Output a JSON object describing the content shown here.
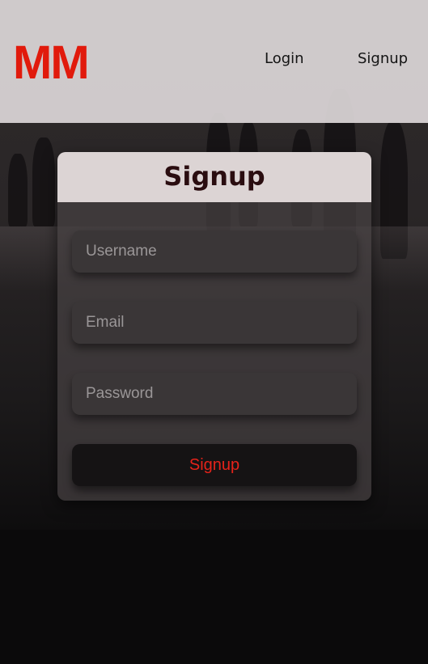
{
  "header": {
    "logo": "MM",
    "nav": {
      "login": "Login",
      "signup": "Signup"
    }
  },
  "form": {
    "title": "Signup",
    "username_placeholder": "Username",
    "email_placeholder": "Email",
    "password_placeholder": "Password",
    "submit_label": "Signup"
  },
  "colors": {
    "brand_red": "#e11a0c",
    "title_color": "#2a0d10",
    "header_bg": "#dcd6d7"
  }
}
